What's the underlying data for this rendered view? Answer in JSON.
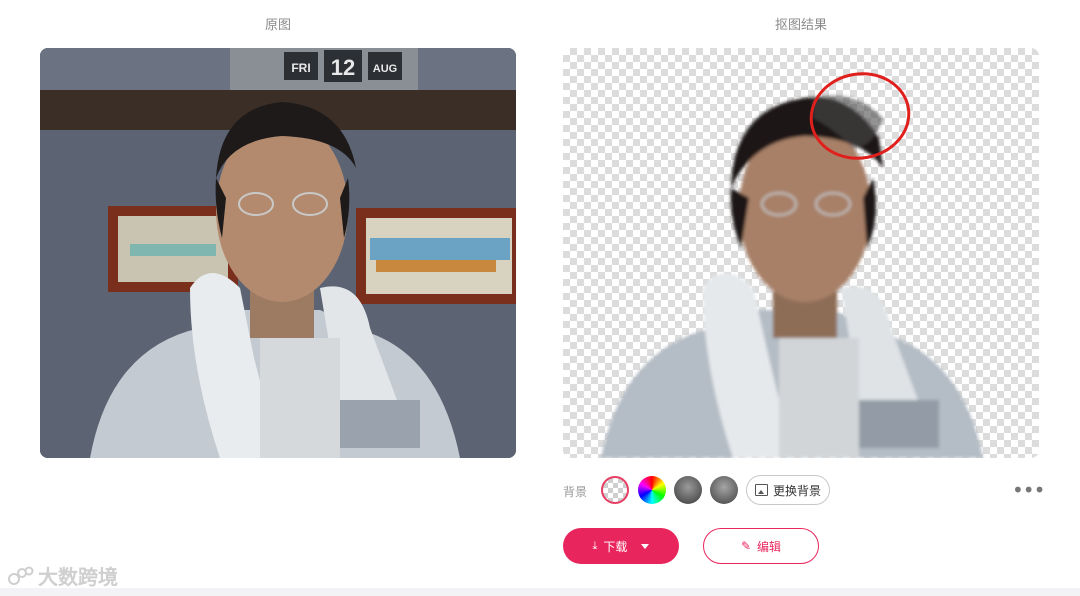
{
  "columns": {
    "original_title": "原图",
    "result_title": "抠图结果"
  },
  "photo_original": {
    "calendar_day": "FRI",
    "calendar_date": "12",
    "calendar_month": "AUG"
  },
  "background_bar": {
    "label": "背景",
    "swatches": [
      "transparent",
      "color-wheel",
      "photo-1",
      "photo-2"
    ],
    "change_label": "更换背景",
    "more_icon": "more-horizontal-icon"
  },
  "actions": {
    "download_label": "下载",
    "edit_label": "编辑"
  },
  "watermark": {
    "text": "大数跨境"
  },
  "colors": {
    "accent": "#e8265d",
    "annotation_circle": "#e0201c"
  }
}
